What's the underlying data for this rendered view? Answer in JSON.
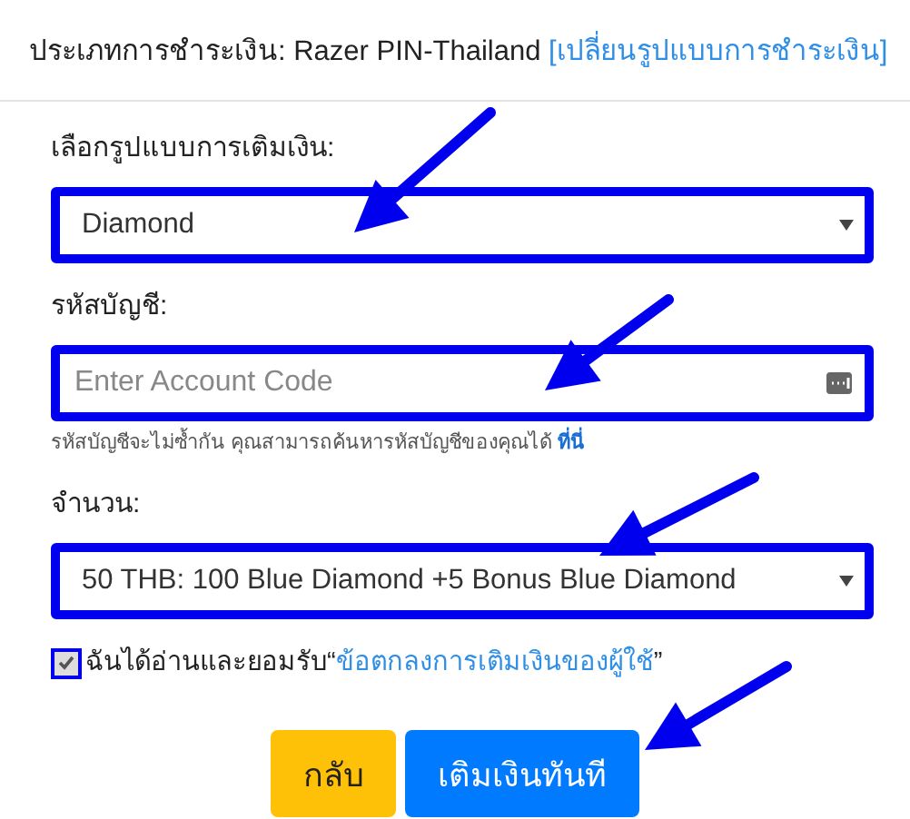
{
  "payment": {
    "label": "ประเภทการชำระเงิน: Razer PIN-Thailand",
    "link": "[เปลี่ยนรูปแบบการชำระเงิน]"
  },
  "fields": [
    {
      "kind": "select",
      "label": "เลือกรูปแบบการเติมเงิน:",
      "value": "Diamond"
    },
    {
      "kind": "input",
      "label": "รหัสบัญชี:",
      "placeholder": "Enter Account Code",
      "help": "รหัสบัญชีจะไม่ซ้ำกัน คุณสามารถค้นหารหัสบัญชีของคุณได้",
      "help_link": "ที่นี่"
    },
    {
      "kind": "select",
      "label": "จำนวน:",
      "value": "50 THB: 100 Blue Diamond +5 Bonus Blue Diamond"
    }
  ],
  "agreement": {
    "checked": true,
    "text": "ฉันได้อ่านและยอมรับ“",
    "link": "ข้อตกลงการเติมเงินของผู้ใช้",
    "close": "”"
  },
  "buttons": [
    {
      "kind": "back",
      "label": "กลับ"
    },
    {
      "kind": "primary",
      "label": "เติมเงินทันที"
    }
  ]
}
